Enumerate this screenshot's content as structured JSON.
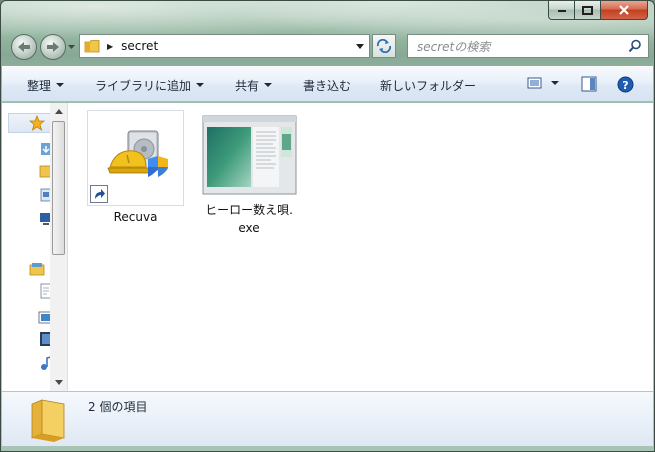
{
  "window": {
    "caption_buttons": {
      "minimize": "minimize",
      "maximize": "maximize",
      "close": "close"
    }
  },
  "navigation": {
    "back_icon": "back-arrow-icon",
    "forward_icon": "forward-arrow-icon",
    "address_path": "secret",
    "search_placeholder": "secretの検索"
  },
  "toolbar": {
    "organize": "整理",
    "add_to_library": "ライブラリに追加",
    "share": "共有",
    "burn": "書き込む",
    "new_folder": "新しいフォルダー"
  },
  "files": [
    {
      "name": "Recuva",
      "icon": "recuva-shortcut-icon"
    },
    {
      "name": "ヒーロー数え唄.",
      "name_line2": "exe",
      "icon": "exe-thumbnail-icon"
    }
  ],
  "details": {
    "item_count": "2 個の項目"
  },
  "colors": {
    "toolbar_text": "#1e2a3a",
    "close_button": "#c1401f",
    "exe_green": "#3d9a7a"
  }
}
